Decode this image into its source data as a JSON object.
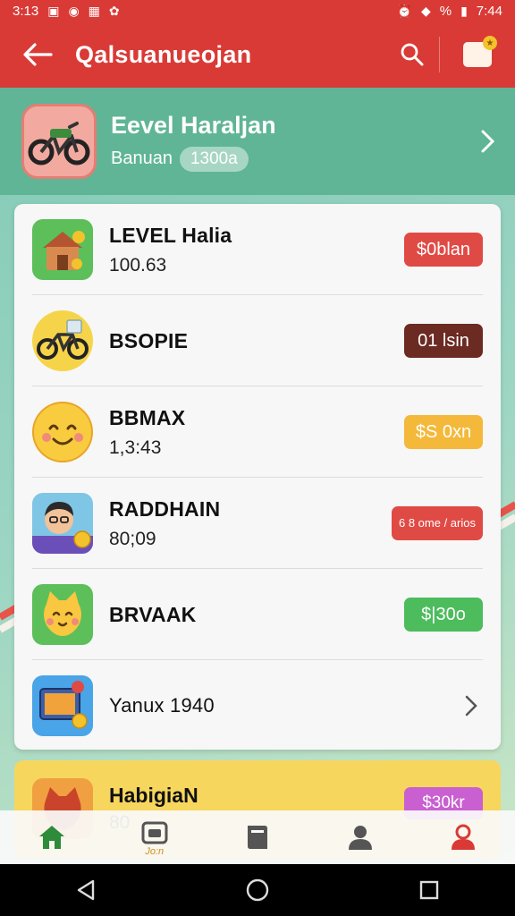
{
  "status_bar": {
    "time_left": "3:13",
    "percent": "%",
    "time_right": "7:44"
  },
  "app_bar": {
    "title": "Qalsuanueojan"
  },
  "profile": {
    "name": "Eevel Haraljan",
    "subtitle": "Banuan",
    "pill": "1300a"
  },
  "list": {
    "items": [
      {
        "title": "LEVEL Halia",
        "value": "100.63",
        "badge": "$0blan",
        "badge_color": "#e04a45",
        "icon": "house-coins-icon"
      },
      {
        "title": "BSOPIE",
        "value": "",
        "badge": "01 lsin",
        "badge_color": "#6b2a22",
        "icon": "motorcycle-icon"
      },
      {
        "title": "BBMAX",
        "value": "1,3:43",
        "badge": "$S 0xn",
        "badge_color": "#f4b93a",
        "icon": "smiley-face-icon"
      },
      {
        "title": "RADDHAIN",
        "value": "80;09",
        "badge": "6 8 ome / arios",
        "badge_color": "#e04a45",
        "icon": "person-avatar-icon"
      },
      {
        "title": "BRVAAK",
        "value": "",
        "badge": "$|30o",
        "badge_color": "#4cbc5c",
        "icon": "cat-face-icon"
      }
    ],
    "last_item": {
      "label": "Yanux 1940",
      "icon": "tv-coin-icon"
    }
  },
  "peek": {
    "title": "HabigiaN",
    "value": "80",
    "badge": "$30kr",
    "icon": "fox-icon"
  },
  "bottom_nav": {
    "items": [
      {
        "icon": "home-icon",
        "label": "",
        "color": "#2e8b3a"
      },
      {
        "icon": "wallet-icon",
        "label": "Jo:n",
        "color": "#555555"
      },
      {
        "icon": "book-icon",
        "label": "",
        "color": "#555555"
      },
      {
        "icon": "person-icon",
        "label": "",
        "color": "#555555"
      },
      {
        "icon": "profile-active-icon",
        "label": "",
        "color": "#d93a36"
      }
    ]
  },
  "colors": {
    "accent": "#d93a36",
    "header_green": "#5fb596"
  }
}
